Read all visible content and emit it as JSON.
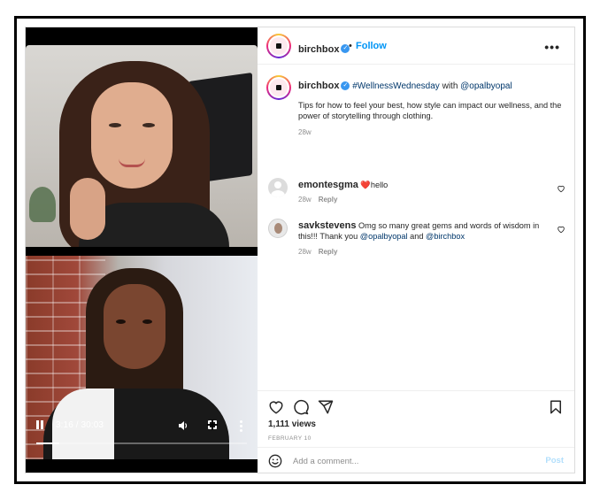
{
  "header": {
    "username": "birchbox",
    "separator": "•",
    "follow_label": "Follow",
    "more_label": "•••"
  },
  "caption": {
    "username": "birchbox",
    "hashtag": "#WellnessWednesday",
    "with_text": " with ",
    "mention": "@opalbyopal",
    "text": "Tips for how to feel your best, how style can impact our wellness, and the power of storytelling through clothing.",
    "age": "28w"
  },
  "comments": [
    {
      "username": "emontesgma",
      "emoji": "❤️",
      "text": "hello",
      "age": "28w",
      "reply_label": "Reply"
    },
    {
      "username": "savkstevens",
      "text_before": "Omg so many great gems and words of wisdom in this!!! Thank you ",
      "mention1": "@opalbyopal",
      "and_text": " and ",
      "mention2": "@birchbox",
      "age": "28w",
      "reply_label": "Reply"
    }
  ],
  "video": {
    "time": "3:16 / 30:03",
    "progress": 0.109
  },
  "actions": {
    "views": "1,111 views",
    "date": "FEBRUARY 10"
  },
  "add_comment": {
    "placeholder": "Add a comment...",
    "post_label": "Post"
  },
  "colors": {
    "accent": "#0095f6",
    "verified": "#3897f0",
    "heart": "#e0245e"
  },
  "icons": [
    "play-pause-icon",
    "volume-icon",
    "fullscreen-icon",
    "more-vertical-icon",
    "verified-badge-icon",
    "more-horizontal-icon",
    "heart-icon",
    "comment-icon",
    "share-icon",
    "save-icon",
    "emoji-icon"
  ]
}
